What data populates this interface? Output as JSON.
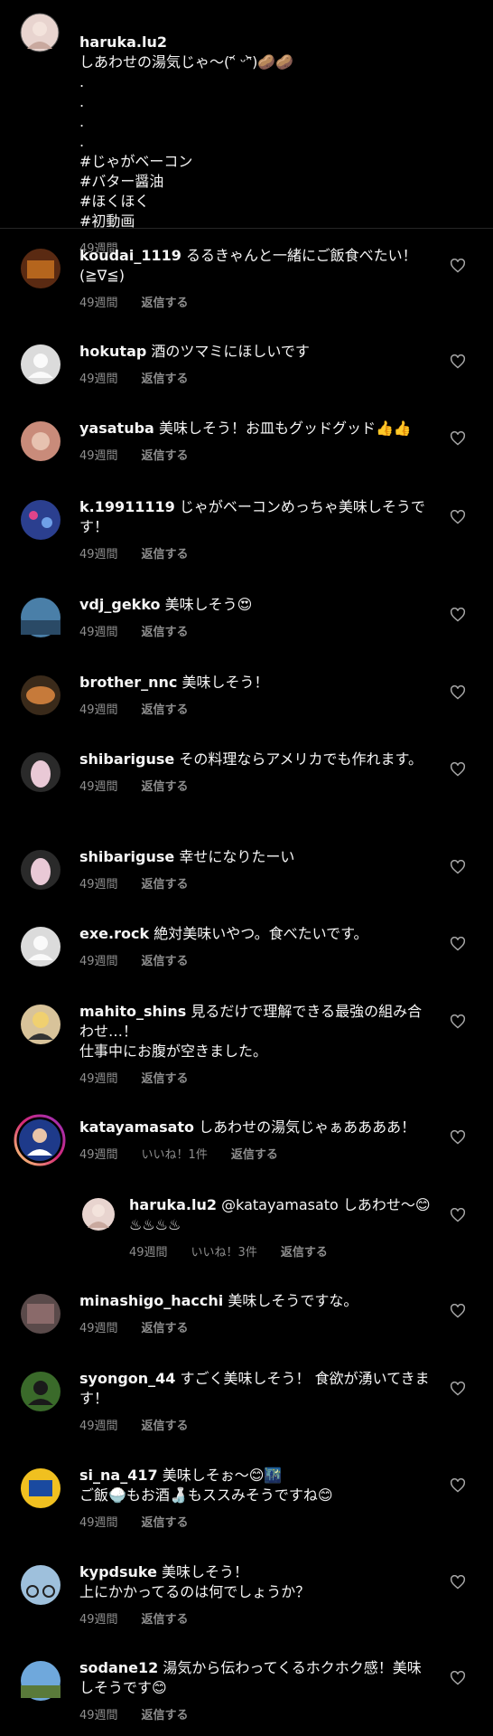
{
  "caption": {
    "username": "haruka.lu2",
    "text": "しあわせの湯気じゃ〜(ᵔ᷄ ᵕᵔ᷅)🥔🥔\n.\n.\n.\n.\n#じゃがベーコン\n#バター醤油\n#ほくほく\n#初動画",
    "time": "49週間"
  },
  "labels": {
    "reply": "返信する"
  },
  "comments": [
    {
      "username": "koudai_1119",
      "text": "るるきゃんと一緒にご飯食べたい！(≧∇≦)",
      "time": "49週間"
    },
    {
      "username": "hokutap",
      "text": "酒のツマミにほしいです",
      "time": "49週間"
    },
    {
      "username": "yasatuba",
      "text": "美味しそう！お皿もグッドグッド👍👍",
      "time": "49週間"
    },
    {
      "username": "k.19911119",
      "text": "じゃがベーコンめっちゃ美味しそうです！",
      "time": "49週間"
    },
    {
      "username": "vdj_gekko",
      "text": "美味しそう😍",
      "time": "49週間"
    },
    {
      "username": "brother_nnc",
      "text": "美味しそう！",
      "time": "49週間"
    },
    {
      "username": "shibariguse",
      "text": "その料理ならアメリカでも作れます。",
      "time": "49週間"
    },
    {
      "username": "shibariguse",
      "text": "幸せになりたーい",
      "time": "49週間"
    },
    {
      "username": "exe.rock",
      "text": "絶対美味いやつ。食べたいです。",
      "time": "49週間"
    },
    {
      "username": "mahito_shins",
      "text": "見るだけで理解できる最強の組み合わせ…！\n仕事中にお腹が空きました。",
      "time": "49週間"
    },
    {
      "username": "katayamasato",
      "text": "しあわせの湯気じゃぁああああ！",
      "time": "49週間",
      "likes": "いいね！1件"
    },
    {
      "username": "haruka.lu2",
      "text": "@katayamasato しあわせ〜😊♨♨♨♨",
      "time": "49週間",
      "likes": "いいね！3件"
    },
    {
      "username": "minashigo_hacchi",
      "text": "美味しそうですな。",
      "time": "49週間"
    },
    {
      "username": "syongon_44",
      "text": "すごく美味しそう！ 食欲が湧いてきます！",
      "time": "49週間"
    },
    {
      "username": "si_na_417",
      "text": "美味しそぉ〜😊🌃\nご飯🍚もお酒🍶もススみそうですね😊",
      "time": "49週間"
    },
    {
      "username": "kypdsuke",
      "text": "美味しそう！\n上にかかってるのは何でしょうか？",
      "time": "49週間"
    },
    {
      "username": "sodane12",
      "text": "湯気から伝わってくるホクホク感！美味しそうです😊",
      "time": "49週間"
    }
  ]
}
